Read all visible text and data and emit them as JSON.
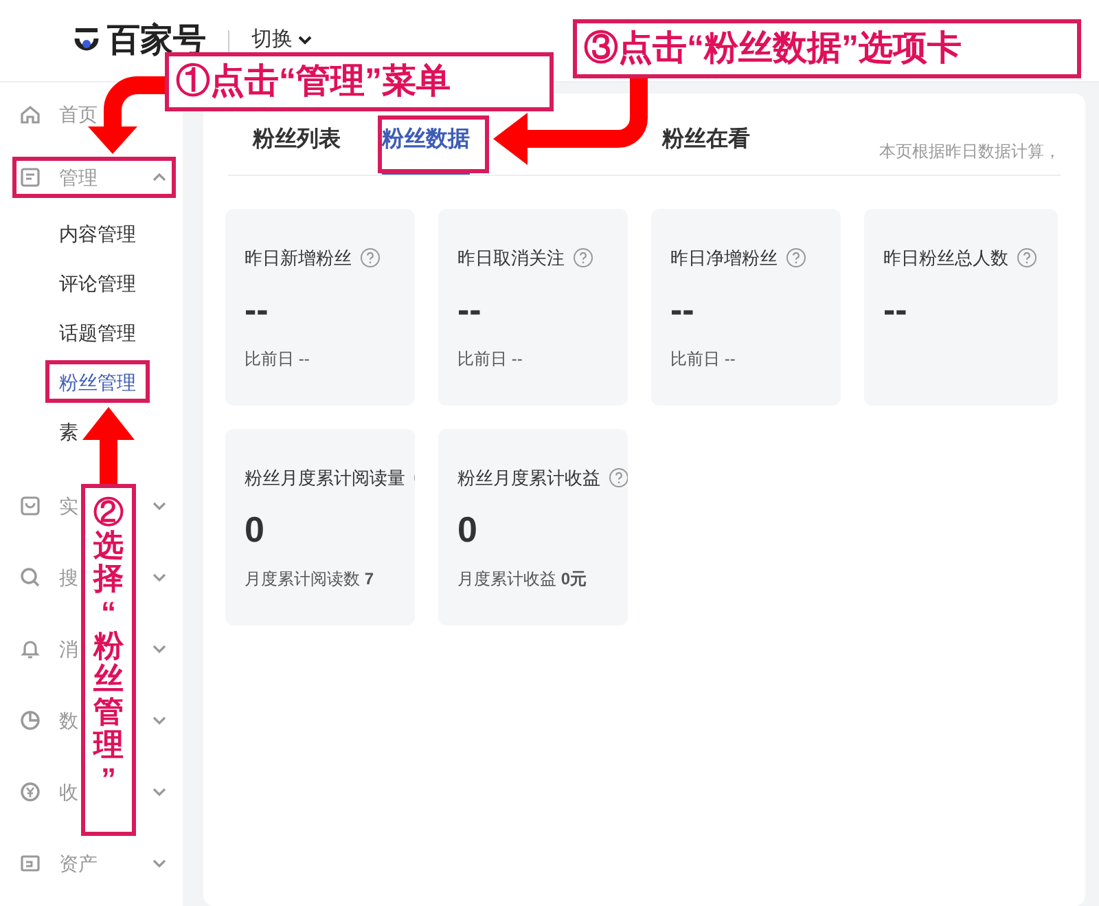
{
  "header": {
    "logo": "百家号",
    "switch": "切换"
  },
  "sidebar": {
    "items": [
      {
        "label": "首页",
        "kind": "link"
      },
      {
        "label": "管理",
        "kind": "group",
        "expanded": true,
        "children": [
          {
            "label": "内容管理",
            "selected": false
          },
          {
            "label": "评论管理",
            "selected": false
          },
          {
            "label": "话题管理",
            "selected": false
          },
          {
            "label": "粉丝管理",
            "selected": true
          },
          {
            "label": "素",
            "selected": false
          }
        ]
      },
      {
        "label": "实",
        "kind": "group",
        "expanded": false
      },
      {
        "label": "搜",
        "kind": "group",
        "expanded": false
      },
      {
        "label": "消",
        "kind": "group",
        "expanded": false
      },
      {
        "label": "数",
        "kind": "group",
        "expanded": false
      },
      {
        "label": "收",
        "kind": "group",
        "expanded": false
      },
      {
        "label": "资产",
        "kind": "group",
        "expanded": false
      }
    ]
  },
  "tabs": [
    {
      "label": "粉丝列表",
      "selected": false
    },
    {
      "label": "粉丝数据",
      "selected": true
    },
    {
      "label": "粉丝在看",
      "selected": false
    }
  ],
  "note": "本页根据昨日数据计算，",
  "cards": [
    {
      "title": "昨日新增粉丝",
      "value": "--",
      "compare": "比前日 --"
    },
    {
      "title": "昨日取消关注",
      "value": "--",
      "compare": "比前日 --"
    },
    {
      "title": "昨日净增粉丝",
      "value": "--",
      "compare": "比前日 --"
    },
    {
      "title": "昨日粉丝总人数",
      "value": "--"
    },
    {
      "title": "粉丝月度累计阅读量",
      "value": "0",
      "compare": "月度累计阅读数 **7**"
    },
    {
      "title": "粉丝月度累计收益",
      "value": "0",
      "compare": "月度累计收益 **0元**"
    }
  ],
  "annotations": [
    {
      "kind": "callout",
      "text": "①点击“管理”菜单"
    },
    {
      "kind": "callout",
      "text": "③点击“粉丝数据”选项卡"
    },
    {
      "kind": "vertical",
      "text": "②选择“粉丝管理”"
    }
  ]
}
